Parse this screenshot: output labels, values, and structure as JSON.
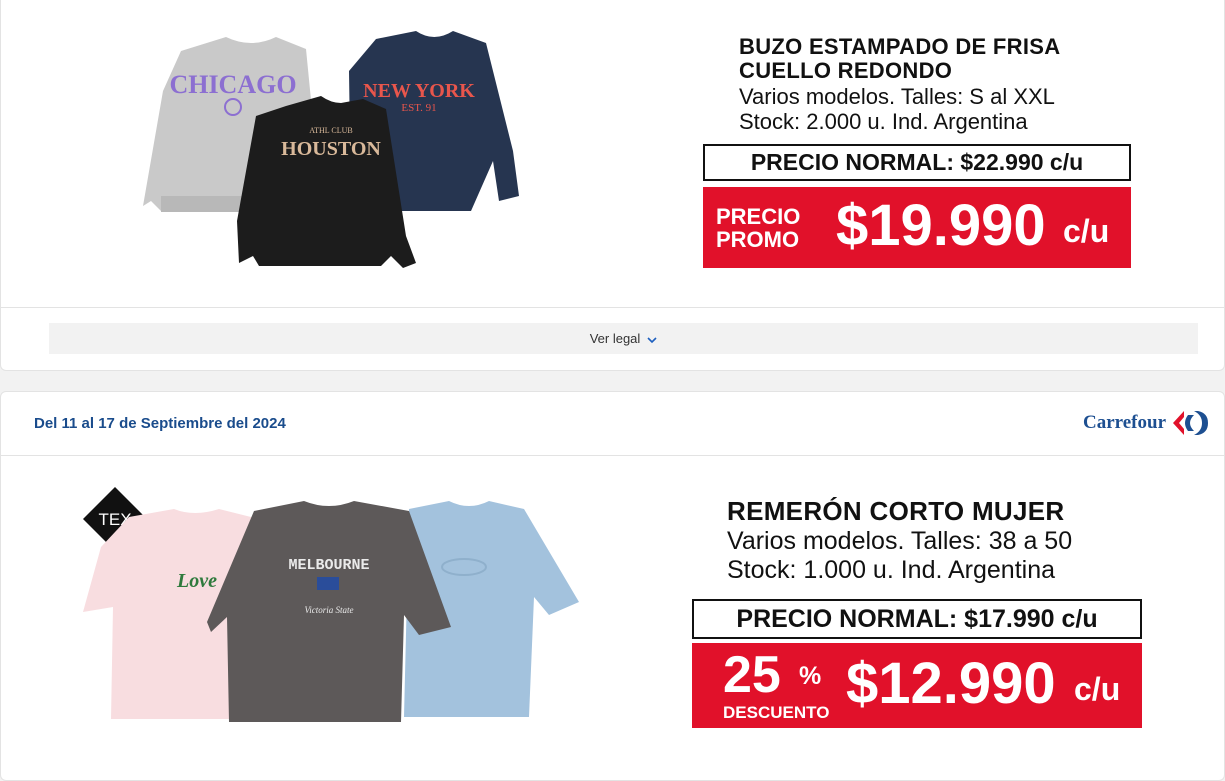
{
  "offer1": {
    "title": "BUZO ESTAMPADO DE FRISA\nCUELLO REDONDO",
    "details_line1": "Varios modelos. Talles: S al XXL",
    "details_line2": "Stock: 2.000 u. Ind. Argentina",
    "normal_price": "PRECIO NORMAL: $22.990 c/u",
    "promo_label": "PRECIO\nPROMO",
    "promo_price": "$19.990",
    "promo_unit": "c/u",
    "image_prints": [
      "CHICAGO",
      "HOUSTON",
      "NEW YORK",
      "EST. 91",
      "ATHL CLUB"
    ],
    "legal_link": "Ver legal"
  },
  "offer2": {
    "date_range": "Del 11 al 17 de Septiembre del 2024",
    "brand": "Carrefour",
    "badge": "TEX",
    "title": "REMERÓN CORTO MUJER",
    "details_line1": "Varios modelos. Talles: 38 a 50",
    "details_line2": "Stock: 1.000 u. Ind. Argentina",
    "normal_price": "PRECIO NORMAL: $17.990 c/u",
    "discount_value": "25",
    "discount_sign": "%",
    "discount_label": "DESCUENTO",
    "promo_price": "$12.990",
    "promo_unit": "c/u",
    "image_prints": [
      "Love",
      "MELBOURNE",
      "Victoria State"
    ]
  },
  "colors": {
    "promo_red": "#e1112a",
    "brand_blue": "#1d4f91",
    "date_blue": "#1a4c8c"
  }
}
